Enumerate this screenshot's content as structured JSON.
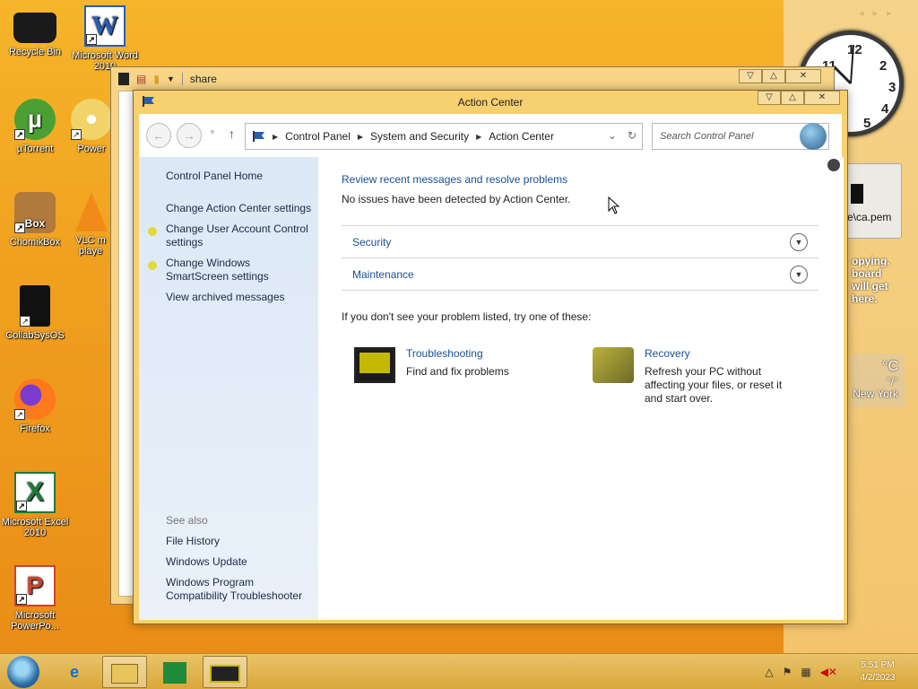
{
  "desktop": {
    "icons": [
      {
        "label": "Recycle Bin"
      },
      {
        "label": "Microsoft Word 2010"
      },
      {
        "label": "µTorrent"
      },
      {
        "label": "Power"
      },
      {
        "label": "ChomikBox"
      },
      {
        "label": "VLC m playe"
      },
      {
        "label": "CollabSysOS"
      },
      {
        "label": "Firefox"
      },
      {
        "label": "Microsoft Excel 2010"
      },
      {
        "label": "Microsoft PowerPo..."
      }
    ],
    "gadgets": {
      "card_text": "e\\ca.pem",
      "clip_lines": [
        "opying.",
        "board",
        "will get",
        "here."
      ],
      "weather_temp": "°C",
      "weather_sub": "°/°",
      "weather_city": "New York"
    }
  },
  "background_window": {
    "path": "share"
  },
  "window": {
    "title": "Action Center",
    "address": {
      "crumbs": [
        "Control Panel",
        "System and Security",
        "Action Center"
      ]
    },
    "search_placeholder": "Search Control Panel",
    "left_pane": {
      "home": "Control Panel Home",
      "links": [
        "Change Action Center settings",
        "Change User Account Control settings",
        "Change Windows SmartScreen settings",
        "View archived messages"
      ],
      "see_also_heading": "See also",
      "see_also": [
        "File History",
        "Windows Update",
        "Windows Program Compatibility Troubleshooter"
      ]
    },
    "content": {
      "header_link": "Review recent messages and resolve problems",
      "status": "No issues have been detected by Action Center.",
      "sections": [
        "Security",
        "Maintenance"
      ],
      "try_text": "If you don't see your problem listed, try one of these:",
      "tiles": [
        {
          "title": "Troubleshooting",
          "desc": "Find and fix problems"
        },
        {
          "title": "Recovery",
          "desc": "Refresh your PC without affecting your files, or reset it and start over."
        }
      ]
    }
  },
  "taskbar": {
    "time": "5:51 PM",
    "date": "4/2/2023"
  }
}
